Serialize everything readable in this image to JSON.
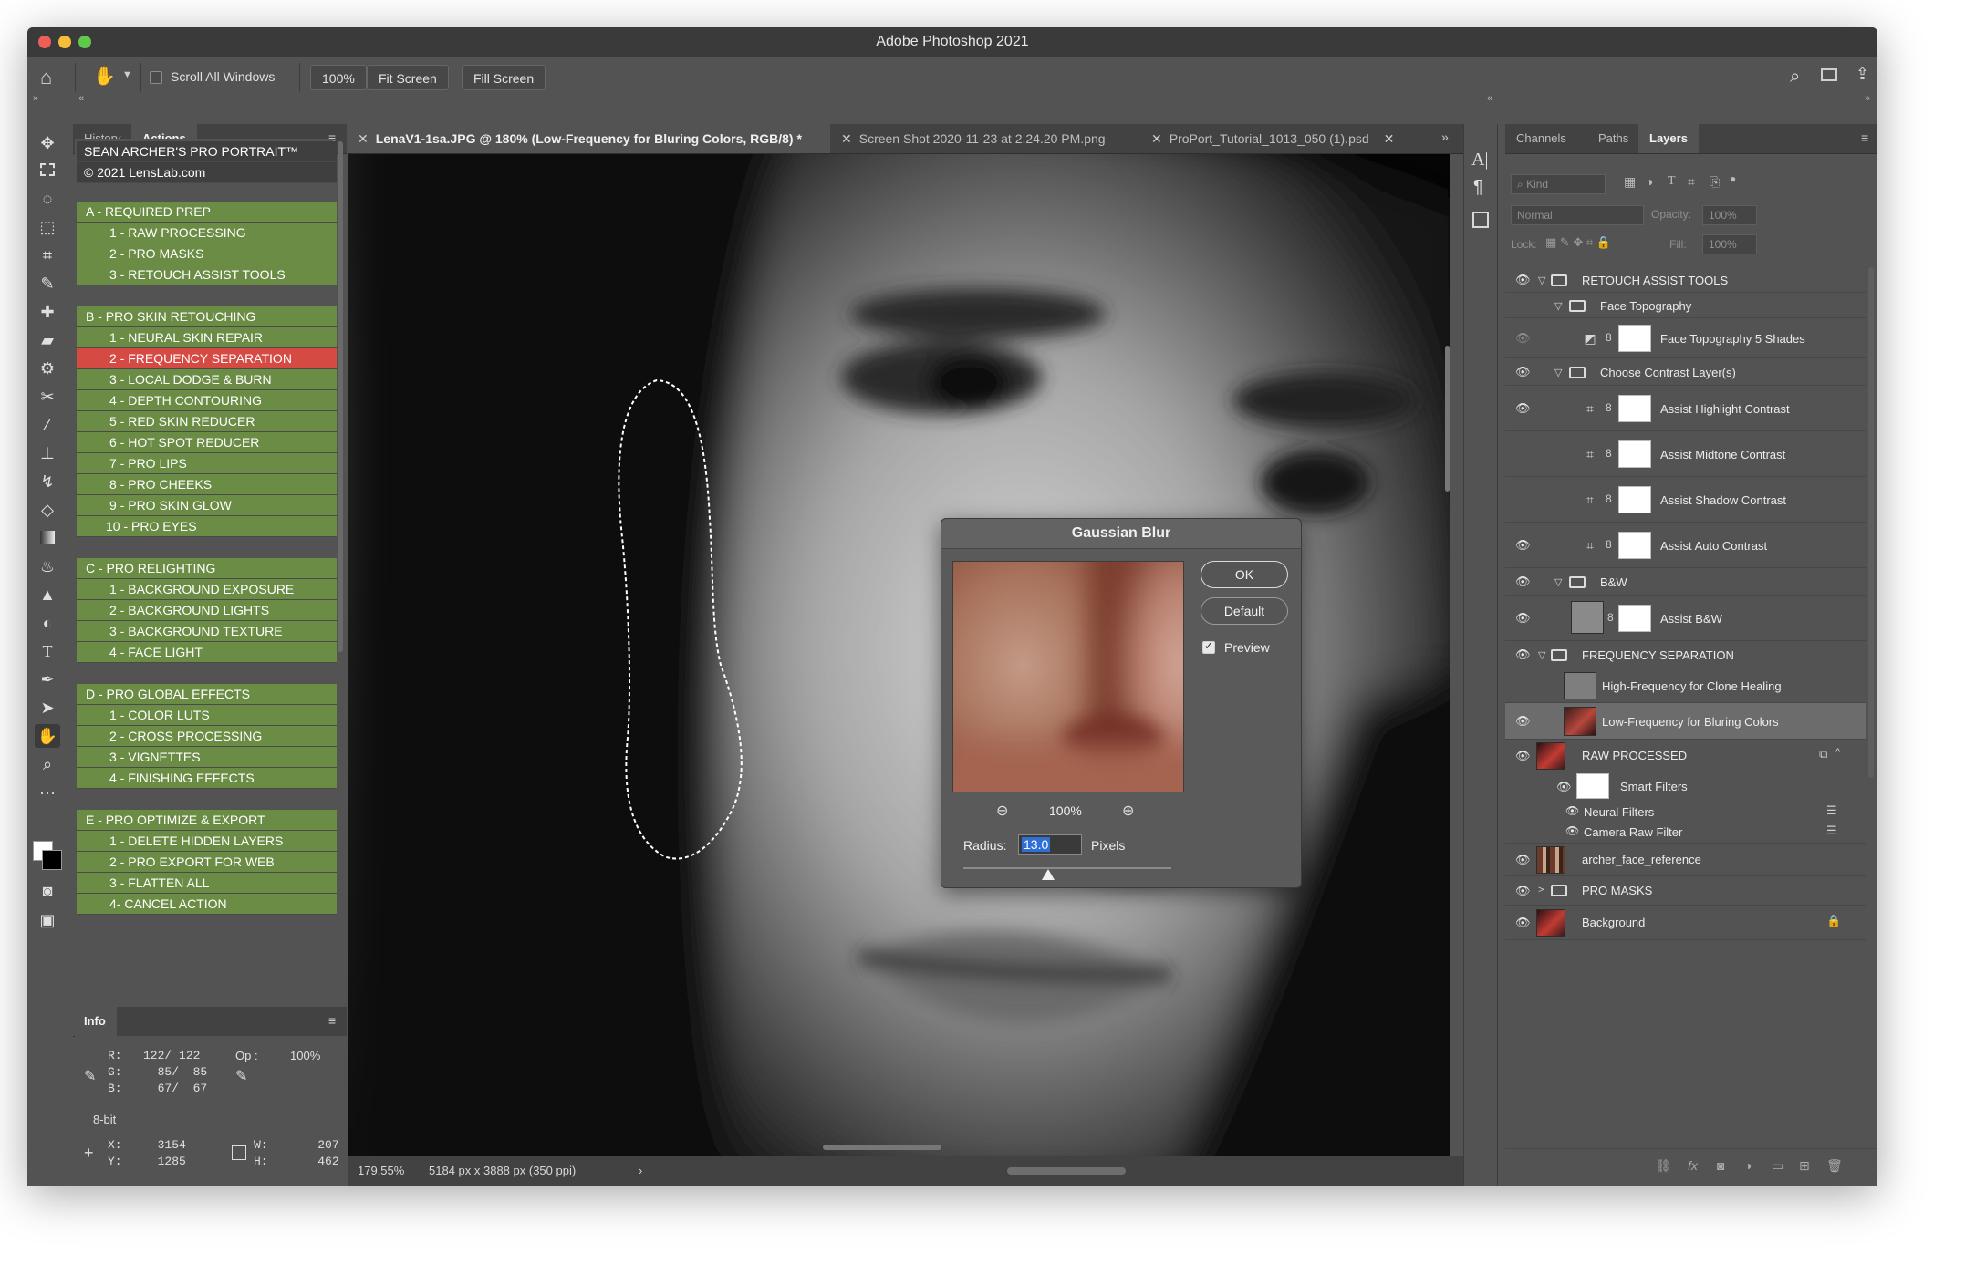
{
  "window": {
    "title": "Adobe Photoshop 2021"
  },
  "options_bar": {
    "scroll_all_windows": "Scroll All Windows",
    "zoom": "100%",
    "fit_screen": "Fit Screen",
    "fill_screen": "Fill Screen"
  },
  "left_panel": {
    "tabs": [
      "History",
      "Actions"
    ],
    "header_lines": [
      "SEAN ARCHER'S PRO PORTRAIT™",
      "© 2021 LensLab.com"
    ],
    "sections": [
      {
        "title": "A - REQUIRED PREP",
        "items": [
          "1 - RAW PROCESSING",
          "2 - PRO MASKS",
          "3 - RETOUCH ASSIST TOOLS"
        ]
      },
      {
        "title": "B - PRO SKIN RETOUCHING",
        "items": [
          "1 - NEURAL SKIN REPAIR",
          "2 - FREQUENCY SEPARATION",
          "3 - LOCAL DODGE & BURN",
          "4 - DEPTH CONTOURING",
          "5 - RED SKIN REDUCER",
          "6 - HOT SPOT REDUCER",
          "7 - PRO LIPS",
          "8 - PRO CHEEKS",
          "9 - PRO SKIN GLOW",
          "10 - PRO EYES"
        ]
      },
      {
        "title": "C - PRO RELIGHTING",
        "items": [
          "1 - BACKGROUND EXPOSURE",
          "2 - BACKGROUND LIGHTS",
          "3 - BACKGROUND TEXTURE",
          "4 - FACE LIGHT"
        ]
      },
      {
        "title": "D - PRO GLOBAL EFFECTS",
        "items": [
          "1 - COLOR LUTS",
          "2 - CROSS PROCESSING",
          "3 - VIGNETTES",
          "4 - FINISHING EFFECTS"
        ]
      },
      {
        "title": "E - PRO OPTIMIZE & EXPORT",
        "items": [
          "1 - DELETE HIDDEN LAYERS",
          "2 - PRO EXPORT FOR WEB",
          "3 - FLATTEN ALL",
          "4- CANCEL ACTION"
        ]
      }
    ],
    "highlighted_item": "2 - FREQUENCY SEPARATION"
  },
  "info_panel": {
    "tab": "Info",
    "r": "R:   122/ 122",
    "g": "G:     85/  85",
    "b": "B:     67/  67",
    "op_label": "Op :",
    "op_value": "100%",
    "bit": "8-bit",
    "x": "X:     3154",
    "y": "Y:     1285",
    "w": "W:       207",
    "h": "H:       462"
  },
  "document_tabs": [
    {
      "label": "LenaV1-1sa.JPG @ 180% (Low-Frequency for Bluring Colors, RGB/8) *",
      "active": true
    },
    {
      "label": "Screen Shot 2020-11-23 at 2.24.20 PM.png",
      "active": false
    },
    {
      "label": "ProPort_Tutorial_1013_050 (1).psd",
      "active": false
    }
  ],
  "status_bar": {
    "zoom": "179.55%",
    "doc_size": "5184 px x 3888 px (350 ppi)"
  },
  "gaussian_blur": {
    "title": "Gaussian Blur",
    "ok": "OK",
    "default": "Default",
    "preview": "Preview",
    "zoom": "100%",
    "radius_label": "Radius:",
    "radius_value": "13.0",
    "units": "Pixels",
    "slider_fraction": 0.41
  },
  "layers_panel": {
    "tabs": [
      "Channels",
      "Paths",
      "Layers"
    ],
    "kind_placeholder": "Kind",
    "blend_mode": "Normal",
    "opacity_label": "Opacity:",
    "opacity_value": "100%",
    "lock_label": "Lock:",
    "fill_label": "Fill:",
    "fill_value": "100%",
    "layers": {
      "retouch_assist_tools": "RETOUCH ASSIST TOOLS",
      "face_topography": "Face Topography",
      "face_topography_5_shades": "Face Topography 5 Shades",
      "choose_contrast": "Choose Contrast Layer(s)",
      "assist_highlight": "Assist Highlight Contrast",
      "assist_midtone": "Assist Midtone Contrast",
      "assist_shadow": "Assist Shadow Contrast",
      "assist_auto": "Assist Auto Contrast",
      "bw_group": "B&W",
      "assist_bw": "Assist B&W",
      "frequency_separation": "FREQUENCY SEPARATION",
      "high_freq": "High-Frequency for Clone Healing",
      "low_freq": "Low-Frequency for Bluring Colors",
      "raw_processed": "RAW PROCESSED",
      "smart_filters": "Smart Filters",
      "neural_filters": "Neural Filters",
      "camera_raw": "Camera Raw Filter",
      "archer_ref": "archer_face_reference",
      "pro_masks": "PRO MASKS",
      "background": "Background"
    }
  },
  "colors": {
    "accent_green": "#6b8c45",
    "accent_red": "#d64a44",
    "panel": "#535353"
  }
}
